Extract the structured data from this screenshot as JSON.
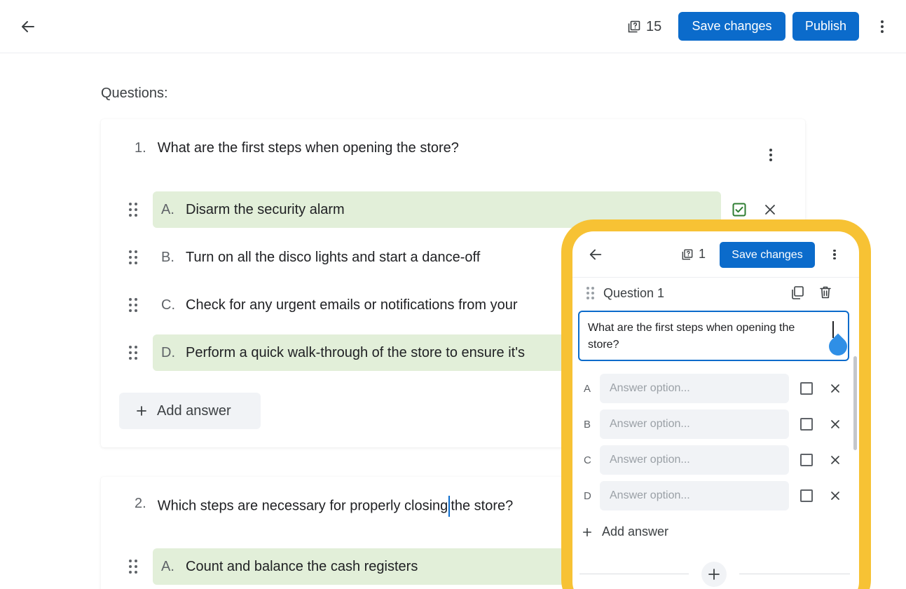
{
  "topbar": {
    "question_count": "15",
    "save_label": "Save changes",
    "publish_label": "Publish"
  },
  "questions_label": "Questions:",
  "questions": [
    {
      "number": "1.",
      "text": "What are the first steps when opening the store?",
      "answers": [
        {
          "letter": "A.",
          "text": "Disarm the security alarm",
          "correct": true
        },
        {
          "letter": "B.",
          "text": "Turn on all the disco lights and start a dance-off",
          "correct": false
        },
        {
          "letter": "C.",
          "text": "Check for any urgent emails or notifications from your",
          "correct": false
        },
        {
          "letter": "D.",
          "text": "Perform a quick walk-through of the store to ensure it's",
          "correct": true
        }
      ],
      "add_answer_label": "Add answer"
    },
    {
      "number": "2.",
      "text_before_caret": "Which steps are necessary for properly closing",
      "text_after_caret": "the store?",
      "answers": [
        {
          "letter": "A.",
          "text": "Count and balance the cash registers",
          "correct": true
        }
      ]
    }
  ],
  "phone": {
    "question_count": "1",
    "save_label": "Save changes",
    "question_title": "Question 1",
    "question_text": "What are the first steps when opening the store?",
    "answers": [
      {
        "letter": "A",
        "placeholder": "Answer option..."
      },
      {
        "letter": "B",
        "placeholder": "Answer option..."
      },
      {
        "letter": "C",
        "placeholder": "Answer option..."
      },
      {
        "letter": "D",
        "placeholder": "Answer option..."
      }
    ],
    "add_answer_label": "Add answer"
  },
  "colors": {
    "primary": "#0b6bcb",
    "correct_bg": "#e2efd9",
    "correct_check": "#2e7d32",
    "phone_frame": "#f7c234"
  }
}
